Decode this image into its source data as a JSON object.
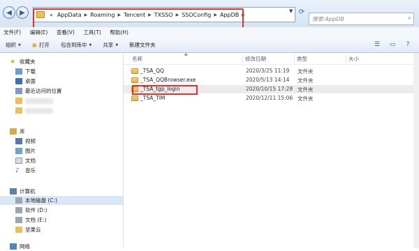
{
  "address": {
    "prefix": "«",
    "segments": [
      "AppData",
      "Roaming",
      "Tencent",
      "TXSSO",
      "SSOConfig",
      "AppDB"
    ],
    "search_placeholder": "搜索 AppDB"
  },
  "menu": [
    "文件(F)",
    "编辑(E)",
    "查看(V)",
    "工具(T)",
    "帮助(H)"
  ],
  "toolbar": {
    "organize": "组织",
    "open": "打开",
    "include": "包含到库中",
    "share": "共享",
    "new_folder": "新建文件夹"
  },
  "nav": {
    "favorites": "收藏夹",
    "downloads": "下载",
    "desktop": "桌面",
    "recent": "最近访问的位置",
    "libraries": "库",
    "videos": "视频",
    "pictures": "图片",
    "documents": "文档",
    "music": "音乐",
    "computer": "计算机",
    "local_c": "本地磁盘 (C:)",
    "soft_d": "软件 (D:)",
    "docs_e": "文档 (E:)",
    "jianguo": "坚果云",
    "network": "网络"
  },
  "columns": {
    "name": "名称",
    "date": "修改日期",
    "type": "类型",
    "size": "大小"
  },
  "files": [
    {
      "name": "_TSA_QQ",
      "date": "2020/3/25 11:19",
      "type": "文件夹"
    },
    {
      "name": "_TSA_QQBrowser.exe",
      "date": "2020/5/13 14:14",
      "type": "文件夹"
    },
    {
      "name": "_TSA_tgp_login",
      "date": "2020/10/15 17:28",
      "type": "文件夹"
    },
    {
      "name": "_TSA_TIM",
      "date": "2020/12/11 15:06",
      "type": "文件夹"
    }
  ]
}
